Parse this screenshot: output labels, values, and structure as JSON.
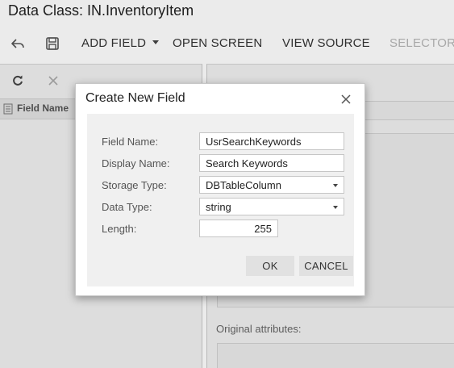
{
  "header": {
    "title": "Data Class: IN.InventoryItem"
  },
  "toolbar": {
    "undo_icon": "undo-arrow-icon",
    "save_icon": "save-disk-icon",
    "add_field_label": "ADD FIELD",
    "open_screen_label": "OPEN SCREEN",
    "view_source_label": "VIEW SOURCE",
    "selector_label": "SELECTOR"
  },
  "left_panel": {
    "refresh_icon": "refresh-icon",
    "delete_icon": "close-icon",
    "grid_header_label": "Field Name"
  },
  "right_panel": {
    "original_attributes_label": "Original attributes:"
  },
  "dialog": {
    "title": "Create New Field",
    "fields": {
      "field_name": {
        "label": "Field Name:",
        "value": "UsrSearchKeywords"
      },
      "display_name": {
        "label": "Display Name:",
        "value": "Search Keywords"
      },
      "storage_type": {
        "label": "Storage Type:",
        "value": "DBTableColumn"
      },
      "data_type": {
        "label": "Data Type:",
        "value": "string"
      },
      "length": {
        "label": "Length:",
        "value": "255"
      }
    },
    "ok_label": "OK",
    "cancel_label": "CANCEL"
  },
  "colors": {
    "panel_background": "#f0f0f0",
    "button_background": "#e1e1e1",
    "disabled_text": "#b7b7b7"
  }
}
